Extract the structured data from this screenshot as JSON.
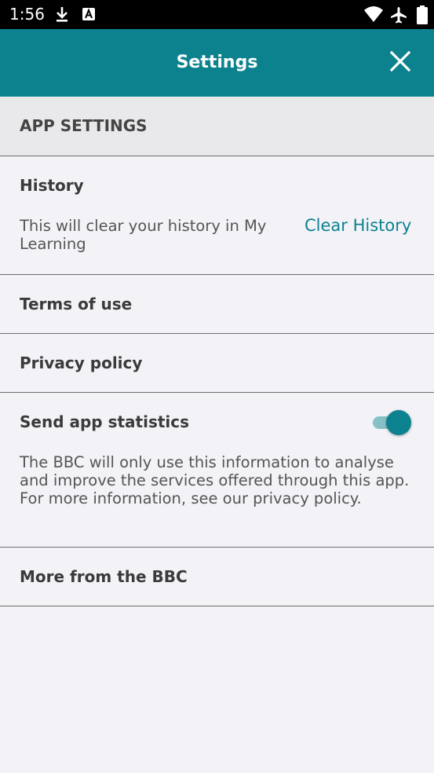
{
  "status_bar": {
    "time": "1:56",
    "icons": [
      "download-icon",
      "a-badge-icon",
      "wifi-icon",
      "airplane-icon",
      "battery-icon"
    ]
  },
  "header": {
    "title": "Settings",
    "close_icon": "close-icon"
  },
  "section": {
    "label": "APP SETTINGS"
  },
  "history": {
    "title": "History",
    "description": "This will clear your history in My Learning",
    "action_label": "Clear History"
  },
  "items": {
    "terms": "Terms of use",
    "privacy": "Privacy policy",
    "more_bbc": "More from the BBC"
  },
  "statistics": {
    "title": "Send app statistics",
    "description": "The BBC will only use this information to analyse and improve the services offered through this app. For more information, see our privacy policy.",
    "enabled": true
  },
  "colors": {
    "accent": "#0c828f",
    "background": "#f2f2f7",
    "section_header_bg": "#e9e9eb"
  }
}
